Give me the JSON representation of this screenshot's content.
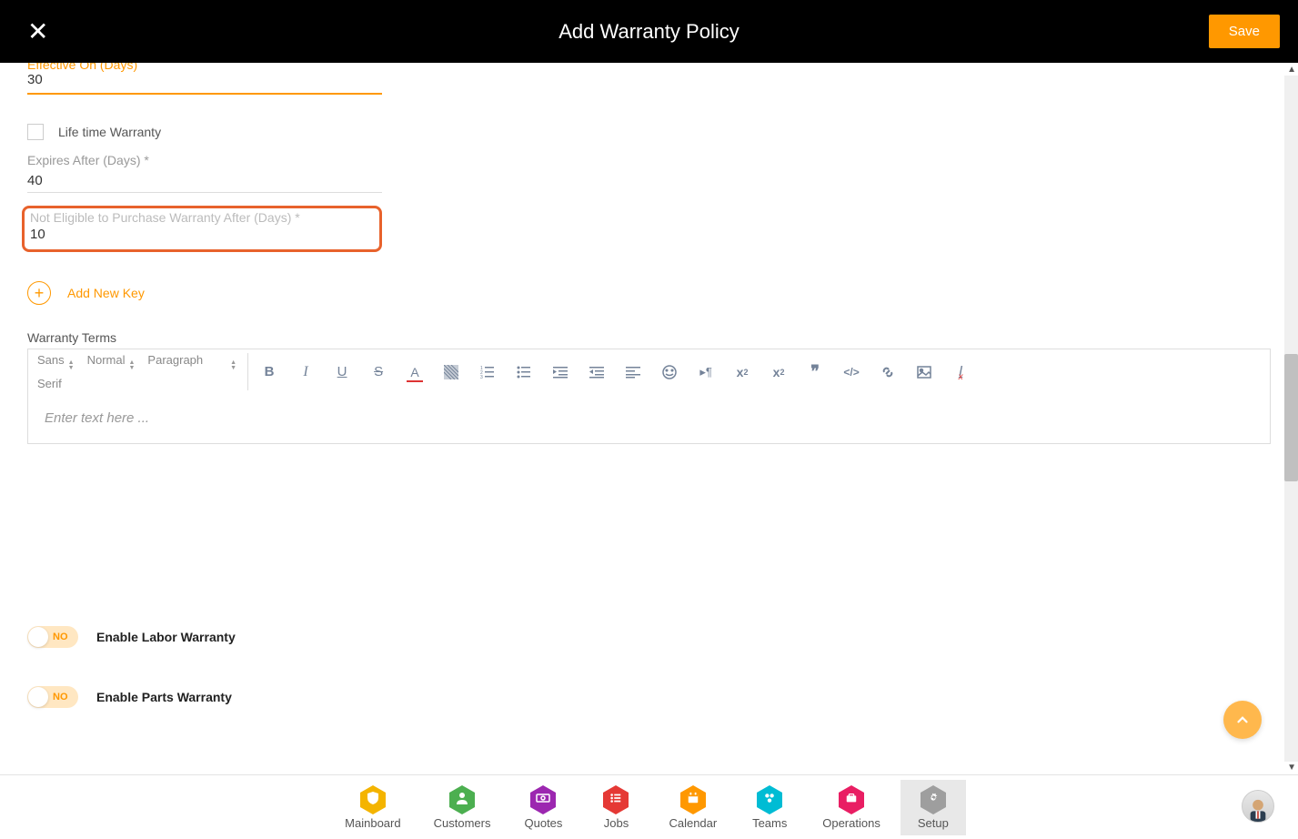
{
  "header": {
    "title": "Add Warranty Policy",
    "save_label": "Save"
  },
  "fields": {
    "effective_on_label": "Effective On (Days)",
    "effective_on_value": "30",
    "lifetime_label": "Life time Warranty",
    "expires_label": "Expires After (Days) *",
    "expires_value": "40",
    "not_eligible_label": "Not Eligible to Purchase Warranty After (Days) *",
    "not_eligible_value": "10",
    "add_key_label": "Add New Key",
    "terms_label": "Warranty Terms",
    "editor_placeholder": "Enter text here ...",
    "font_families": [
      "Sans",
      "Serif"
    ],
    "font_size": "Normal",
    "paragraph": "Paragraph"
  },
  "toggles": {
    "no_label": "NO",
    "labor_label": "Enable Labor Warranty",
    "parts_label": "Enable Parts Warranty"
  },
  "nav": {
    "items": [
      {
        "label": "Mainboard",
        "color": "#f4b400"
      },
      {
        "label": "Customers",
        "color": "#4caf50"
      },
      {
        "label": "Quotes",
        "color": "#9c27b0"
      },
      {
        "label": "Jobs",
        "color": "#e53935"
      },
      {
        "label": "Calendar",
        "color": "#ff9800"
      },
      {
        "label": "Teams",
        "color": "#00bcd4"
      },
      {
        "label": "Operations",
        "color": "#e91e63"
      },
      {
        "label": "Setup",
        "color": "#9e9e9e"
      }
    ]
  }
}
